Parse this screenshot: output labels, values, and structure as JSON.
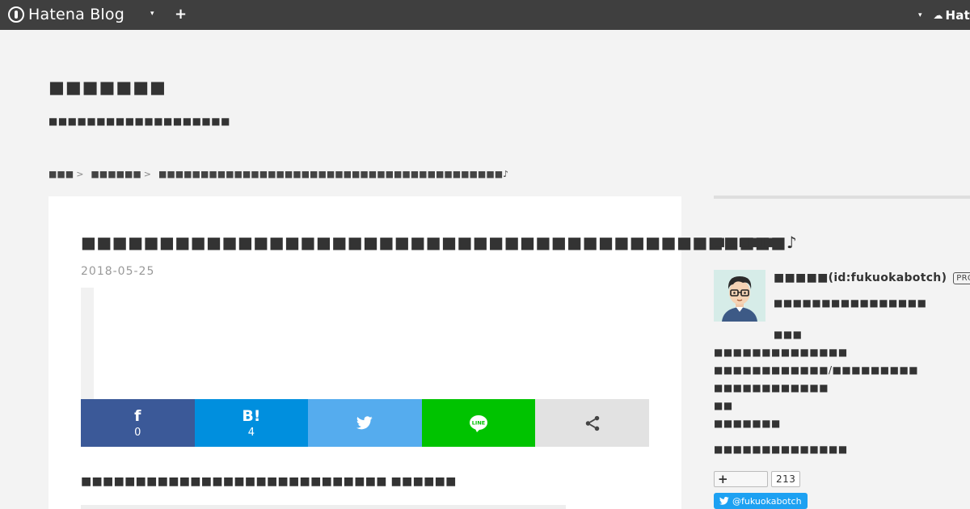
{
  "globalbar": {
    "logo_text": "Hatena Blog",
    "plus_label": "+",
    "caret": "▾",
    "right_brand": "Hat"
  },
  "blog": {
    "title": "■■■■■■■",
    "description": "■■■■■■■■■■■■■■■■■■■"
  },
  "breadcrumb": {
    "items": [
      "■■■",
      "■■■■■■",
      "■■■■■■■■■■■■■■■■■■■■■■■■■■■■■■■■■■■■■■■■■♪"
    ],
    "separator": ">"
  },
  "entry": {
    "title": "■■■■■■■■■■■■■■■■■■■■■■■■■■■■■■■■■■■■■■■■■■■■■♪",
    "date": "2018-05-25",
    "lead": "■■■■■■■■■■■■■■■■■■■■■■■■■■■■ ■■■■■■"
  },
  "share": {
    "facebook": {
      "icon": "f",
      "count": "0"
    },
    "hatena": {
      "icon": "B!",
      "count": "4"
    },
    "twitter": {
      "icon": "🐦"
    },
    "line": {
      "icon": "LINE"
    },
    "other": {
      "icon": "⋖"
    }
  },
  "sidebar": {
    "heading": "■■■■■",
    "profile_name": "■■■■■(id:fukuokabotch)",
    "pro_badge": "PRO",
    "profile_sub": "■■■■■■■■■■■■■■■■",
    "lines": [
      "■■■",
      "■■■■■■■■■■■■■■",
      "■■■■■■■■■■■■/■■■■■■■■■",
      "■■■■■■■■■■■■",
      "■■",
      "■■■■■■■"
    ],
    "more": "■■■■■■■■■■■■■■",
    "follow_plus": "+",
    "follow_count": "213",
    "twitter_handle": "@fukuokabotch"
  },
  "colors": {
    "facebook": "#3b5998",
    "hatena": "#008fde",
    "twitter": "#55acee",
    "line": "#00c300",
    "globalbar": "#3f3f3f"
  }
}
